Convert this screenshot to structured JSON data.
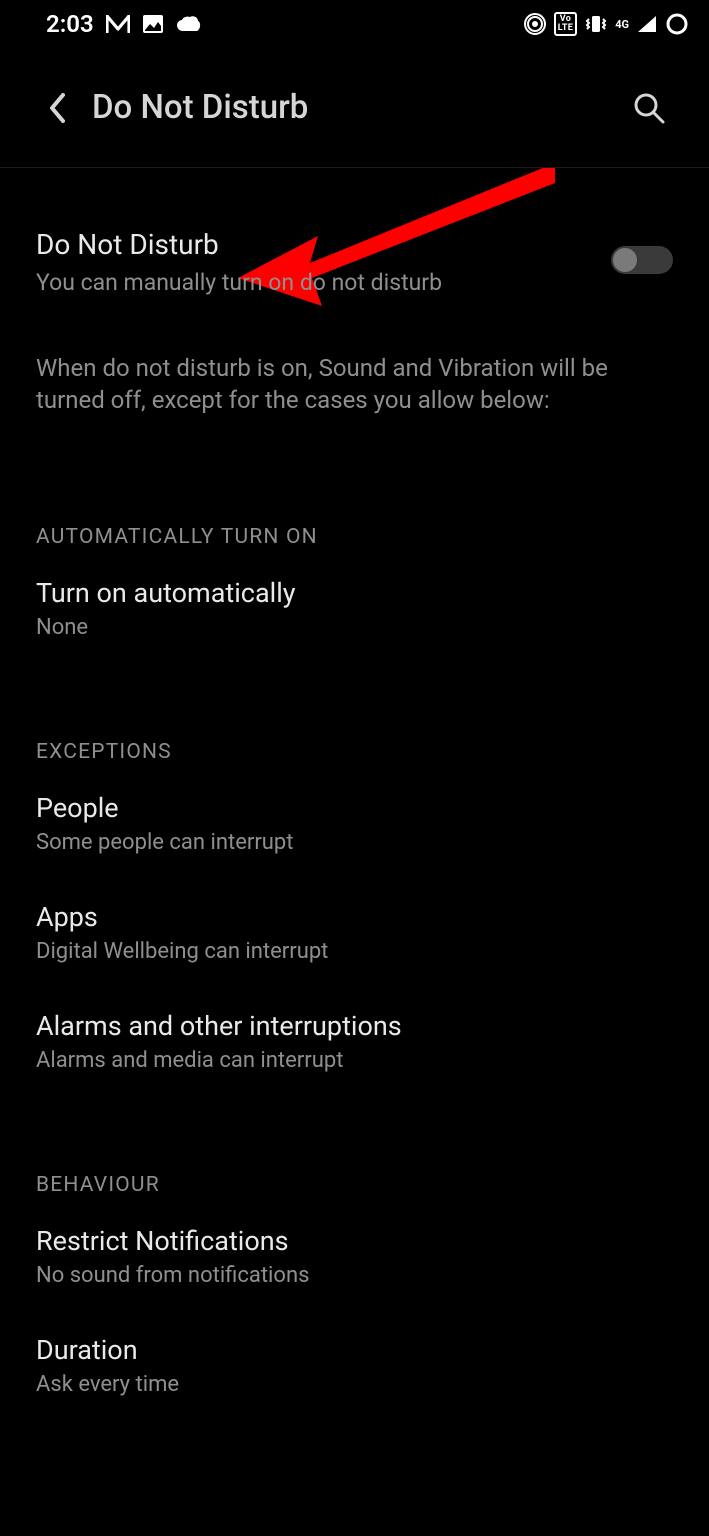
{
  "status": {
    "time": "2:03",
    "network_label": "4G",
    "volte": "Vo\nLTE"
  },
  "header": {
    "title": "Do Not Disturb"
  },
  "dnd": {
    "title": "Do Not Disturb",
    "subtitle": "You can manually turn on do not disturb",
    "info": "When do not disturb is on, Sound and Vibration will be turned off, except for the cases you allow below:"
  },
  "sections": {
    "auto_header": "AUTOMATICALLY TURN ON",
    "auto": {
      "title": "Turn on automatically",
      "sub": "None"
    },
    "exceptions_header": "EXCEPTIONS",
    "people": {
      "title": "People",
      "sub": "Some people can interrupt"
    },
    "apps": {
      "title": "Apps",
      "sub": "Digital Wellbeing can interrupt"
    },
    "alarms": {
      "title": "Alarms and other interruptions",
      "sub": "Alarms and media can interrupt"
    },
    "behaviour_header": "BEHAVIOUR",
    "restrict": {
      "title": "Restrict Notifications",
      "sub": "No sound from notifications"
    },
    "duration": {
      "title": "Duration",
      "sub": "Ask every time"
    }
  }
}
